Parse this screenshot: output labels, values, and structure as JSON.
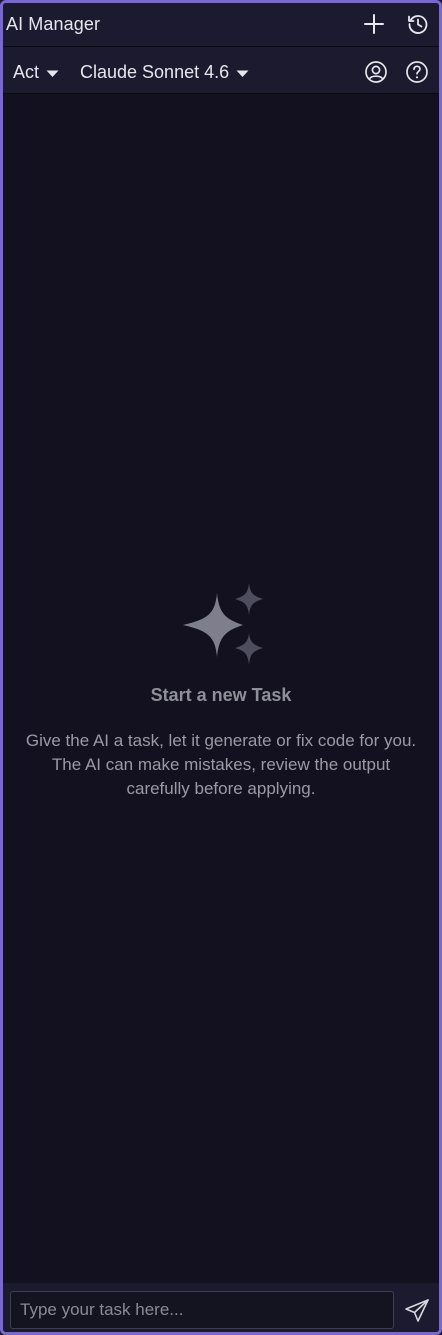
{
  "window": {
    "title": "AI Manager"
  },
  "toolbar": {
    "mode_label": "Act",
    "model_label": "Claude Sonnet 4.6"
  },
  "empty_state": {
    "title": "Start a new Task",
    "description": "Give the AI a task, let it generate or fix code for you. The AI can make mistakes, review the output carefully before applying."
  },
  "input": {
    "value": "",
    "placeholder": "Type your task here..."
  },
  "icons": {
    "new_task": "plus-icon",
    "history": "history-icon",
    "account": "user-circle-icon",
    "help": "help-circle-icon",
    "empty": "sparkles-icon",
    "send": "send-icon"
  },
  "colors": {
    "accent_border": "#7b67d3",
    "background": "#131120",
    "bar": "#1b1a2e",
    "text": "#e6e6ee",
    "muted": "#8f8f99"
  }
}
